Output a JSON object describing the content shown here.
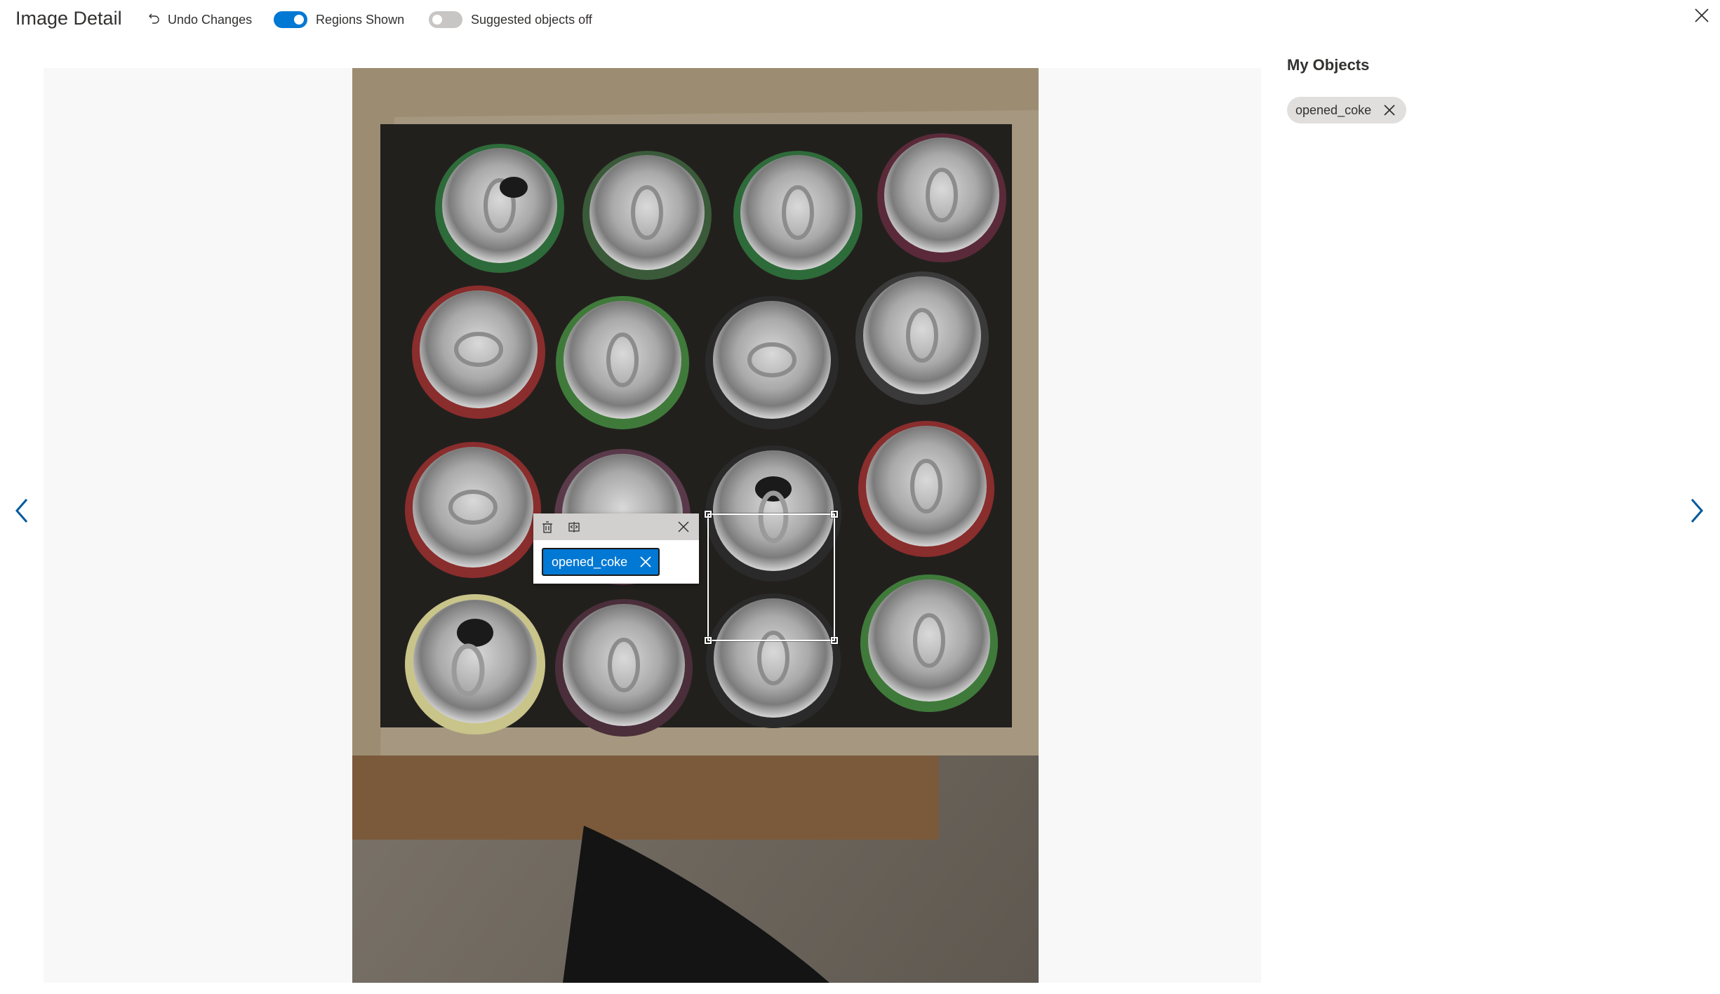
{
  "header": {
    "title": "Image Detail",
    "undo_label": "Undo Changes",
    "regions_toggle": {
      "label": "Regions Shown",
      "state": "on"
    },
    "suggested_toggle": {
      "label": "Suggested objects off",
      "state": "off"
    }
  },
  "region_popup": {
    "tag_label": "opened_coke"
  },
  "side_panel": {
    "title": "My Objects",
    "objects": [
      {
        "label": "opened_coke"
      }
    ]
  },
  "colors": {
    "accent": "#0078d4",
    "toggle_off": "#c8c6c4",
    "chip_bg": "#e1dfdd",
    "canvas_bg": "#f8f8f8"
  },
  "icons": {
    "undo": "undo-icon",
    "close": "close-icon",
    "delete": "trash-icon",
    "compare": "compare-icon",
    "prev": "chevron-left-icon",
    "next": "chevron-right-icon"
  }
}
